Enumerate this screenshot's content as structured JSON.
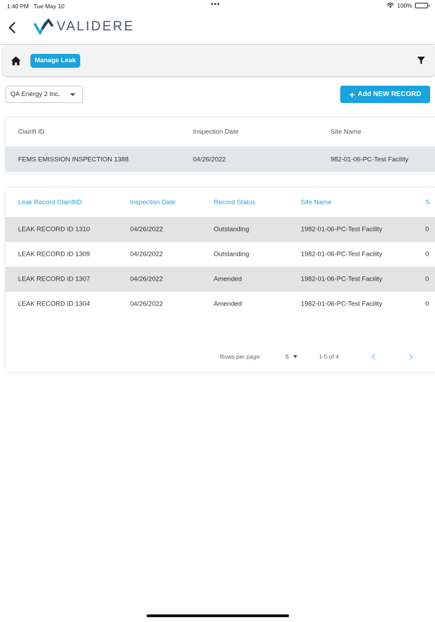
{
  "status_bar": {
    "time": "1:40 PM",
    "date": "Tue May 10",
    "dots": "•••",
    "battery": "100%"
  },
  "header": {
    "logo_text": "VALIDERE",
    "back_icon": "chevron-left-icon"
  },
  "toolbar": {
    "breadcrumb_label": "Manage Leak",
    "home_icon": "home-icon",
    "filter_icon": "filter-icon"
  },
  "company_select": {
    "selected": "QA Energy 2 Inc."
  },
  "add_button": {
    "label": "Add NEW RECORD"
  },
  "inspection_table": {
    "columns": [
      "Clairifi ID",
      "Inspection Date",
      "Site Name"
    ],
    "rows": [
      [
        "FEMS EMISSION INSPECTION 1388",
        "04/26/2022",
        "982-01-06-PC-Test Facility"
      ]
    ]
  },
  "leak_table": {
    "columns": [
      "Leak Record ClairifiID",
      "Inspection Date",
      "Record Status",
      "Site Name",
      "S"
    ],
    "rows": [
      [
        "LEAK RECORD ID 1310",
        "04/26/2022",
        "Outstanding",
        "1982-01-06-PC-Test Facility",
        "0"
      ],
      [
        "LEAK RECORD ID 1309",
        "04/26/2022",
        "Outstanding",
        "1982-01-06-PC-Test Facility",
        "0"
      ],
      [
        "LEAK RECORD ID 1307",
        "04/26/2022",
        "Amended",
        "1982-01-06-PC-Test Facility",
        "0"
      ],
      [
        "LEAK RECORD ID 1304",
        "04/26/2022",
        "Amended",
        "1982-01-06-PC-Test Facility",
        "0"
      ]
    ]
  },
  "pagination": {
    "rows_per_page_label": "Rows per page:",
    "rows_per_page": "5",
    "range": "1-5 of 4"
  },
  "colors": {
    "accent": "#1aa3dc",
    "selected_row": "#e2e6ea",
    "shaded_row": "#e3e3e3"
  }
}
